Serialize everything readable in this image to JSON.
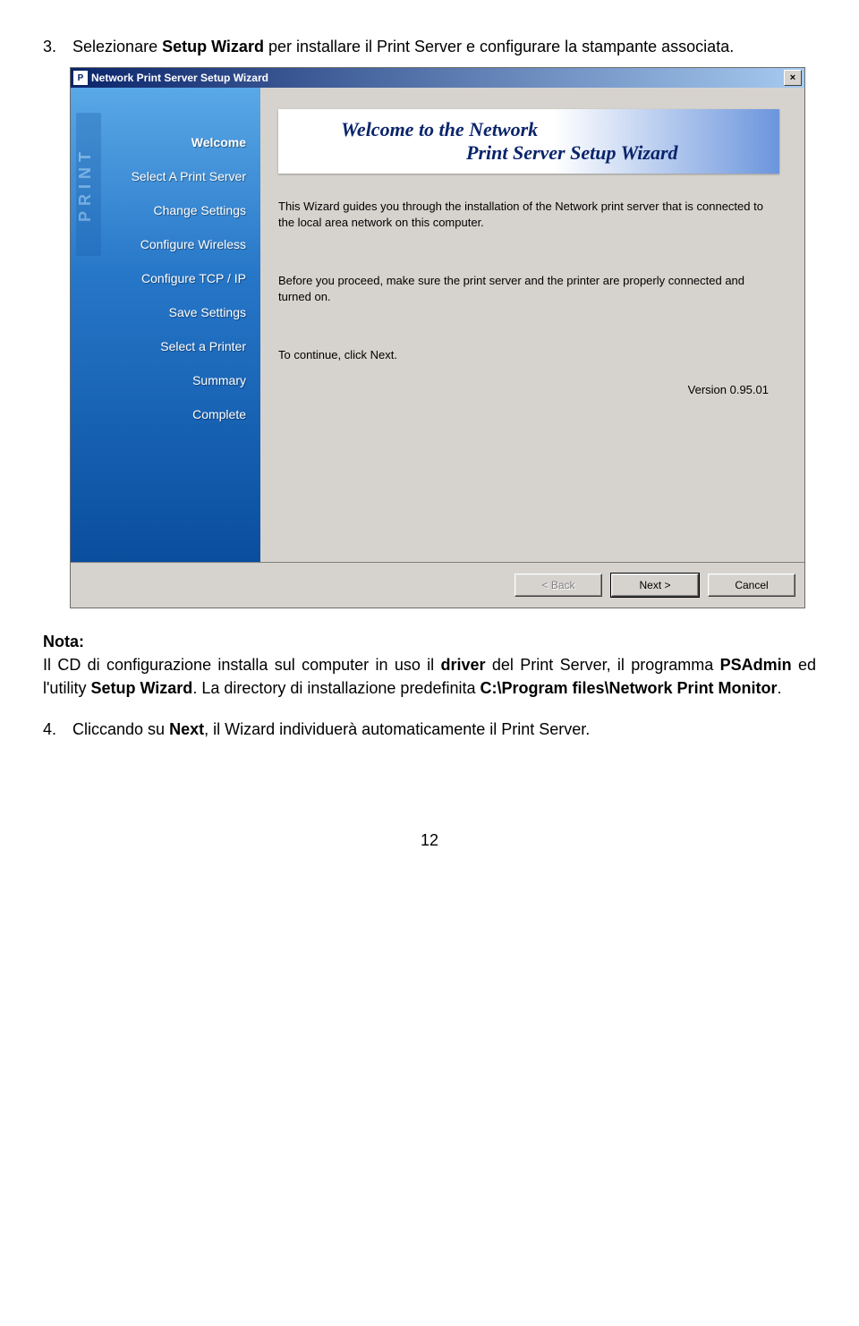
{
  "step3": {
    "num": "3.",
    "pre": "Selezionare ",
    "bold1": "Setup Wizard",
    "post": " per installare il Print Server e configurare la stampante associata."
  },
  "window": {
    "title": "Network Print Server Setup Wizard",
    "close": "×",
    "sidelogo": "PRINT",
    "steps": [
      "Welcome",
      "Select A Print Server",
      "Change Settings",
      "Configure Wireless",
      "Configure TCP / IP",
      "Save Settings",
      "Select a Printer",
      "Summary",
      "Complete"
    ],
    "banner": {
      "line1": "Welcome to the Network",
      "line2": "Print Server Setup Wizard"
    },
    "body": {
      "p1": "This Wizard guides you through the installation of the Network print server that is connected to the local area network on this computer.",
      "p2": "Before you proceed, make sure the print server and the printer are properly connected and turned on.",
      "p3": "To continue, click Next."
    },
    "version": "Version 0.95.01",
    "buttons": {
      "back": "< Back",
      "next": "Next >",
      "cancel": "Cancel"
    }
  },
  "note": {
    "heading": "Nota:",
    "t1": "Il CD di configurazione installa sul computer in uso il ",
    "b1": "driver",
    "t2": " del Print Server, il programma ",
    "b2": "PSAdmin",
    "t3": " ed l'utility ",
    "b3": "Setup Wizard",
    "t4": ". La directory di installazione predefinita ",
    "b4": "C:\\Program files\\Network Print Monitor",
    "t5": "."
  },
  "step4": {
    "num": "4.",
    "t1": "Cliccando su ",
    "b1": "Next",
    "t2": ", il Wizard individuerà automaticamente il Print Server."
  },
  "pagenum": "12"
}
